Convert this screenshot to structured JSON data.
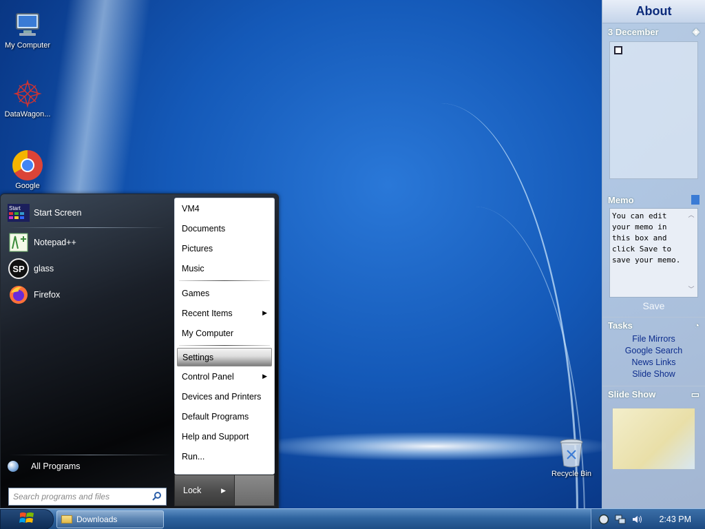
{
  "desktop": {
    "icons": [
      {
        "label": "My Computer",
        "icon": "computer-icon"
      },
      {
        "label": "DataWagon...",
        "icon": "datawagon-icon"
      },
      {
        "label": "Google",
        "icon": "chrome-icon"
      },
      {
        "label": "Recycle Bin",
        "icon": "recycle-bin-icon"
      }
    ]
  },
  "sidebar": {
    "title": "About",
    "calendar_date": "3 December",
    "memo_title": "Memo",
    "memo_text": "You can edit your memo in this box and click Save to save your memo.",
    "save_label": "Save",
    "tasks_title": "Tasks",
    "tasks": [
      "File Mirrors",
      "Google Search",
      "News Links",
      "Slide Show"
    ],
    "slideshow_title": "Slide Show"
  },
  "start_menu": {
    "pinned": [
      {
        "label": "Start Screen",
        "icon": "start-screen-icon"
      },
      {
        "label": "Notepad++",
        "icon": "notepadpp-icon"
      },
      {
        "label": "glass",
        "icon": "glass-icon"
      },
      {
        "label": "Firefox",
        "icon": "firefox-icon"
      }
    ],
    "all_programs": "All Programs",
    "search_placeholder": "Search programs and files",
    "right_items": [
      {
        "label": "VM4",
        "arrow": false
      },
      {
        "label": "Documents",
        "arrow": false
      },
      {
        "label": "Pictures",
        "arrow": false
      },
      {
        "label": "Music",
        "arrow": false
      },
      {
        "label": "Games",
        "arrow": false
      },
      {
        "label": "Recent Items",
        "arrow": true
      },
      {
        "label": "My Computer",
        "arrow": false
      },
      {
        "label": "Settings",
        "arrow": false,
        "highlighted": true
      },
      {
        "label": "Control Panel",
        "arrow": true
      },
      {
        "label": "Devices and Printers",
        "arrow": false
      },
      {
        "label": "Default Programs",
        "arrow": false
      },
      {
        "label": "Help and Support",
        "arrow": false
      },
      {
        "label": "Run...",
        "arrow": false
      }
    ],
    "lock_label": "Lock"
  },
  "taskbar": {
    "task": "Downloads",
    "clock": "2:43 PM"
  }
}
